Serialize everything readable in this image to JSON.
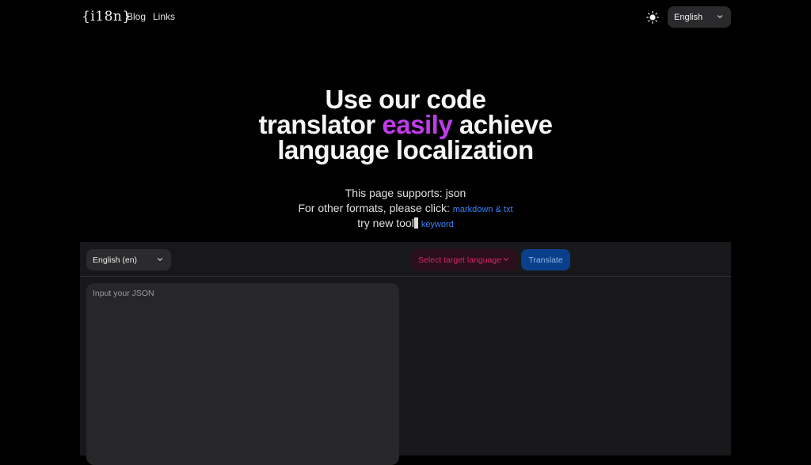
{
  "header": {
    "logo": "{i18n}",
    "nav": [
      {
        "label": "Blog"
      },
      {
        "label": "Links"
      }
    ],
    "theme_icon": "sun-icon",
    "language_select": {
      "value": "English",
      "icon": "chevron-down-icon"
    }
  },
  "hero": {
    "title_line1": "Use our code",
    "title_line2_pre": "translator ",
    "title_line2_accent": "easily",
    "title_line2_post": " achieve",
    "title_line3": "language localization",
    "accent_color": "#c13bea"
  },
  "supports": {
    "line1": "This page supports:  json",
    "line2_text": "For other formats, please click: ",
    "line2_link": "markdown & txt",
    "line3_text": "try new tool",
    "line3_link": "keyword",
    "link_color": "#3b82f6"
  },
  "translator": {
    "source_language": "English (en)",
    "target_placeholder": "Select target language",
    "translate_label": "Translate",
    "input_placeholder": "Input your JSON",
    "input_value": "",
    "output_value": ""
  },
  "colors": {
    "background": "#000000",
    "panel": "#18181a",
    "input_bg": "#27272a",
    "target_text": "#d4256a",
    "translate_bg": "#0a3f8c"
  }
}
